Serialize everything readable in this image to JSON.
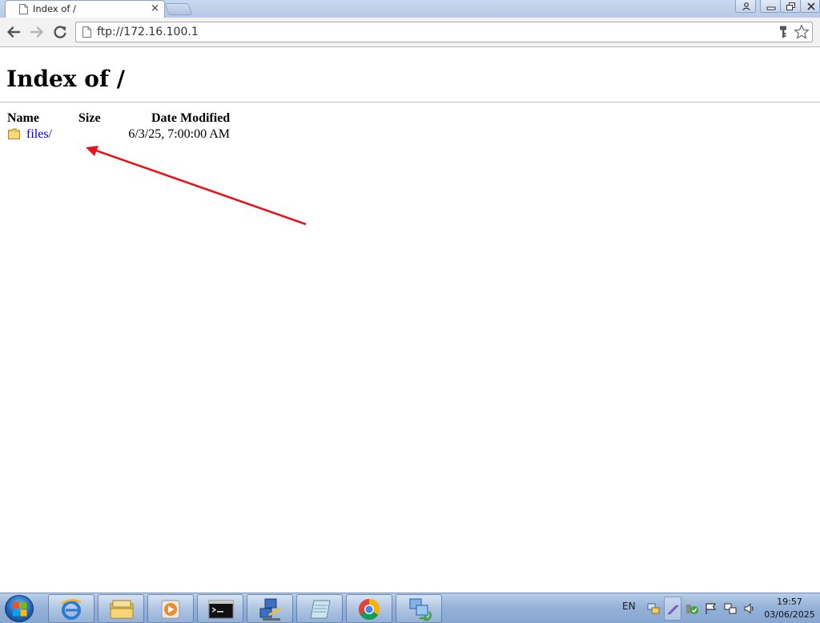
{
  "browser": {
    "tab": {
      "title": "Index of /",
      "close_glyph": "×"
    },
    "address_bar": {
      "url": "ftp://172.16.100.1"
    },
    "icons": {
      "back": "back-arrow-icon",
      "forward": "forward-arrow-icon",
      "reload": "reload-icon",
      "page": "page-icon",
      "key": "key-icon",
      "bookmark": "star-icon"
    }
  },
  "listing": {
    "heading": "Index of /",
    "columns": {
      "name": "Name",
      "size": "Size",
      "date": "Date Modified"
    },
    "entries": [
      {
        "name": "files/",
        "size": "",
        "date": "6/3/25, 7:00:00 AM",
        "icon": "folder-icon"
      }
    ]
  },
  "annotation": {
    "type": "arrow",
    "color": "#e8141c"
  },
  "taskbar": {
    "pinned": [
      "internet-explorer-icon",
      "file-explorer-icon",
      "media-player-icon",
      "command-prompt-icon",
      "network-tool-icon",
      "notepad-icon",
      "chrome-icon",
      "network-share-icon"
    ],
    "tray": {
      "language": "EN",
      "icons": [
        "network-tray-icon",
        "pen-icon",
        "security-check-icon",
        "flag-icon",
        "display-icon",
        "volume-icon"
      ]
    },
    "clock": {
      "time": "19:57",
      "date": "03/06/2025"
    }
  }
}
